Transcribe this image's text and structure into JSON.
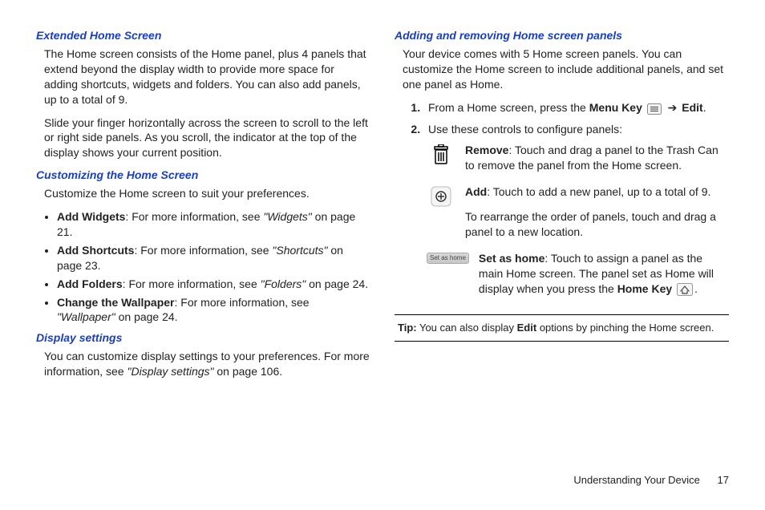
{
  "left": {
    "h1": "Extended Home Screen",
    "p1": "The Home screen consists of the Home panel, plus 4 panels that extend beyond the display width to provide more space for adding shortcuts, widgets and folders. You can also add panels, up to a total of 9.",
    "p2": "Slide your finger horizontally across the screen to scroll to the left or right side panels. As you scroll, the indicator at the top of the display shows your current position.",
    "h2": "Customizing the Home Screen",
    "p3": "Customize the Home screen to suit your preferences.",
    "bullets": [
      {
        "label": "Add Widgets",
        "pre": ": For more information, see ",
        "ref": "\"Widgets\"",
        "post": " on page 21."
      },
      {
        "label": "Add Shortcuts",
        "pre": ": For more information, see ",
        "ref": "\"Shortcuts\"",
        "post": " on page 23."
      },
      {
        "label": "Add Folders",
        "pre": ": For more information, see ",
        "ref": "\"Folders\"",
        "post": " on page 24."
      },
      {
        "label": "Change the Wallpaper",
        "pre": ": For more information, see ",
        "ref": "\"Wallpaper\"",
        "post": " on page 24."
      }
    ],
    "h3": "Display settings",
    "p4_a": "You can customize display settings to your preferences. For more information, see ",
    "p4_ref": "\"Display settings\"",
    "p4_b": " on page 106."
  },
  "right": {
    "h1": "Adding and removing Home screen panels",
    "p1": "Your device comes with 5 Home screen panels. You can customize the Home screen to include additional panels, and set one panel as Home.",
    "step1_a": "From a Home screen, press the ",
    "step1_menu": "Menu Key",
    "step1_arrow": "➔",
    "step1_edit": "Edit",
    "step1_b": ".",
    "step2": "Use these controls to configure panels:",
    "controls": {
      "remove_label": "Remove",
      "remove_text": ": Touch and drag a panel to the Trash Can to remove the panel from the Home screen.",
      "add_label": "Add",
      "add_text_a": ": Touch to add a new panel, up to a total of 9.",
      "add_text_b": "To rearrange the order of panels, touch and drag a panel to a new location.",
      "sethome_btn": "Set as home",
      "sethome_label": "Set as home",
      "sethome_text_a": ": Touch to assign a panel as the main Home screen. The panel set as Home will display when you press the ",
      "sethome_text_key": "Home Key",
      "sethome_text_b": "."
    },
    "tip_label": "Tip:",
    "tip_a": " You can also display ",
    "tip_bold": "Edit",
    "tip_b": " options by pinching the Home screen."
  },
  "footer": {
    "section": "Understanding Your Device",
    "page": "17"
  }
}
